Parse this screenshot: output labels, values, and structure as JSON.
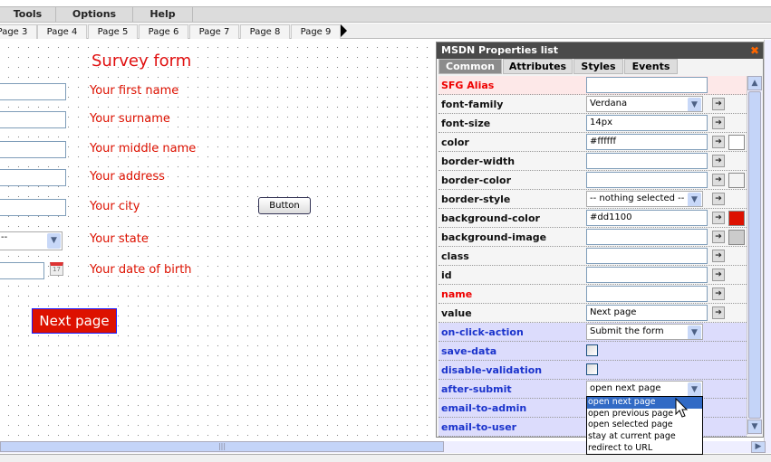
{
  "menu": [
    "Tools",
    "Options",
    "Help"
  ],
  "page_tabs": [
    "Page 3",
    "Page 4",
    "Page 5",
    "Page 6",
    "Page 7",
    "Page 8",
    "Page 9"
  ],
  "form": {
    "title": "Survey form",
    "labels": [
      "Your first name",
      "Your surname",
      "Your middle name",
      "Your address",
      "Your city",
      "Your state",
      "Your date of birth"
    ],
    "state_value": "--",
    "button_label": "Button",
    "calendar_day": "17",
    "next_button": "Next page"
  },
  "panel": {
    "title": "MSDN Properties list",
    "tabs": [
      "Common",
      "Attributes",
      "Styles",
      "Events"
    ],
    "active_tab": "Common",
    "rows": [
      {
        "label": "SFG Alias",
        "value": ""
      },
      {
        "label": "font-family",
        "value": "Verdana"
      },
      {
        "label": "font-size",
        "value": "14px"
      },
      {
        "label": "color",
        "value": "#ffffff"
      },
      {
        "label": "border-width",
        "value": ""
      },
      {
        "label": "border-color",
        "value": ""
      },
      {
        "label": "border-style",
        "value": "-- nothing selected --"
      },
      {
        "label": "background-color",
        "value": "#dd1100"
      },
      {
        "label": "background-image",
        "value": ""
      },
      {
        "label": "class",
        "value": ""
      },
      {
        "label": "id",
        "value": ""
      },
      {
        "label": "name",
        "value": ""
      },
      {
        "label": "value",
        "value": "Next page"
      },
      {
        "label": "on-click-action",
        "value": "Submit the form"
      },
      {
        "label": "save-data",
        "value": ""
      },
      {
        "label": "disable-validation",
        "value": ""
      },
      {
        "label": "after-submit",
        "value": "open next page"
      },
      {
        "label": "email-to-admin",
        "value": ""
      },
      {
        "label": "email-to-user",
        "value": ""
      }
    ],
    "swatch_colors": {
      "color": "#ffffff",
      "border-color": "#f3f3f3",
      "background-color": "#dd1100"
    },
    "dropdown_options": [
      "open next page",
      "open previous page",
      "open selected page",
      "stay at current page",
      "redirect to URL"
    ],
    "dropdown_selected": "open next page"
  }
}
